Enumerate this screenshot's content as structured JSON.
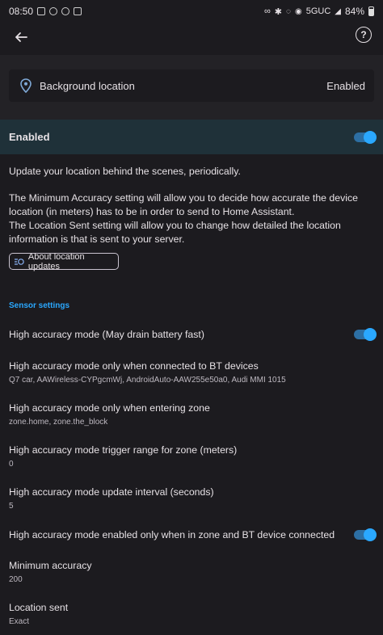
{
  "status_bar": {
    "time": "08:50",
    "network": "5GUC",
    "battery": "84%"
  },
  "top_bar": {
    "help_glyph": "?"
  },
  "sensor": {
    "name": "Background location",
    "state": "Enabled"
  },
  "enable_toggle": {
    "label": "Enabled",
    "on": true
  },
  "description": {
    "line1": "Update your location behind the scenes, periodically.",
    "line2": "The Minimum Accuracy setting will allow you to decide how accurate the device location (in meters) has to be in order to send to Home Assistant.",
    "line3": "The Location Sent setting will allow you to change how detailed the location information is that is sent to your server."
  },
  "about_button": {
    "label": "About location updates"
  },
  "section": {
    "title": "Sensor settings"
  },
  "settings": [
    {
      "title": "High accuracy mode (May drain battery fast)",
      "toggle": true
    },
    {
      "title": "High accuracy mode only when connected to BT devices",
      "value": "Q7 car, AAWireless-CYPgcmWj, AndroidAuto-AAW255e50a0, Audi MMI 1015"
    },
    {
      "title": "High accuracy mode only when entering zone",
      "value": "zone.home, zone.the_block"
    },
    {
      "title": "High accuracy mode trigger range for zone (meters)",
      "value": "0"
    },
    {
      "title": "High accuracy mode update interval (seconds)",
      "value": "5"
    },
    {
      "title": "High accuracy mode enabled only when in zone and BT device connected",
      "toggle": true
    },
    {
      "title": "Minimum accuracy",
      "value": "200"
    },
    {
      "title": "Location sent",
      "value": "Exact"
    }
  ],
  "colors": {
    "accent": "#2aa8ff",
    "background": "#1c1b1f",
    "enabled_band": "#1f3139"
  }
}
